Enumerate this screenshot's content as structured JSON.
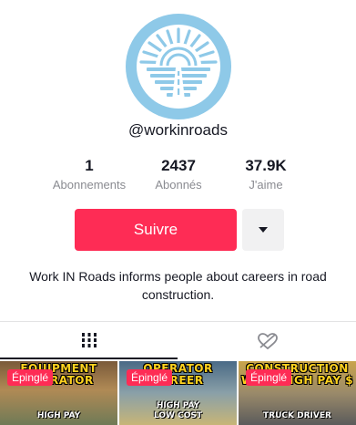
{
  "profile": {
    "username": "@workinroads",
    "bio": "Work IN Roads informs people about careers in road construction.",
    "avatar_icon": "sunrise-road-logo-icon"
  },
  "stats": [
    {
      "value": "1",
      "label": "Abonnements"
    },
    {
      "value": "2437",
      "label": "Abonnés"
    },
    {
      "value": "37.9K",
      "label": "J'aime"
    }
  ],
  "actions": {
    "follow_label": "Suivre",
    "more_icon": "caret-down-icon"
  },
  "tabs": [
    {
      "icon": "grid-icon",
      "selected": true
    },
    {
      "icon": "liked-heart-icon",
      "selected": false
    }
  ],
  "videos": [
    {
      "headline_1": "EQUIPMENT",
      "headline_2": "OPERATOR",
      "pinned_label": "Épinglé",
      "caption": "HIGH PAY"
    },
    {
      "headline_1": "OPERATOR",
      "headline_2": "CAREER",
      "pinned_label": "Épinglé",
      "caption": "HIGH PAY",
      "caption_2": "LOW COST"
    },
    {
      "headline_1": "CONSTRUCTION",
      "headline_2": "WITH HIGH PAY $",
      "pinned_label": "Épinglé",
      "caption": "TRUCK DRIVER"
    }
  ],
  "colors": {
    "accent": "#fe2c55",
    "avatar_blue": "#8ec9e8",
    "secondary_text": "#8a8b91"
  }
}
